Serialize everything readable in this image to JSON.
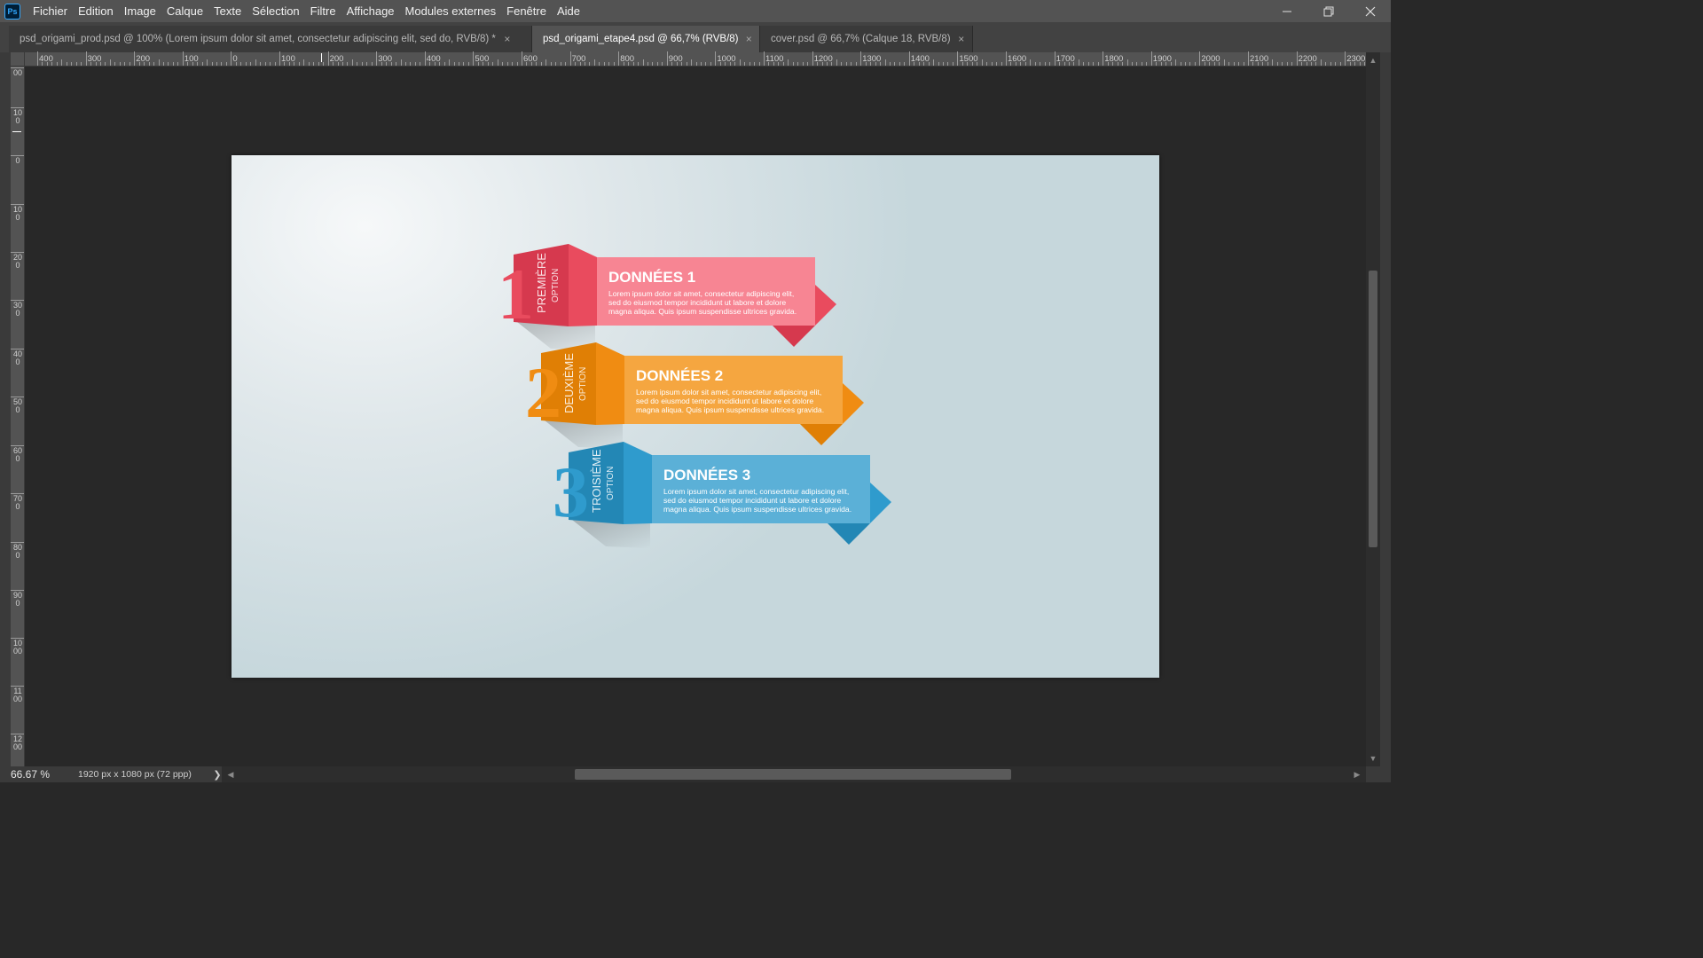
{
  "app": {
    "logo_text": "Ps",
    "menu": [
      "Fichier",
      "Edition",
      "Image",
      "Calque",
      "Texte",
      "Sélection",
      "Filtre",
      "Affichage",
      "Modules externes",
      "Fenêtre",
      "Aide"
    ]
  },
  "tabs": [
    {
      "label": "psd_origami_prod.psd @ 100% (Lorem ipsum dolor sit amet, consectetur adipiscing elit, sed do, RVB/8) *",
      "active": false
    },
    {
      "label": "psd_origami_etape4.psd @ 66,7% (RVB/8)",
      "active": true
    },
    {
      "label": "cover.psd @ 66,7% (Calque 18, RVB/8)",
      "active": false
    }
  ],
  "ruler_top_labels": [
    "400",
    "300",
    "200",
    "100",
    "0",
    "100",
    "200",
    "300",
    "400",
    "500",
    "600",
    "700",
    "800",
    "900",
    "1000",
    "1100",
    "1200",
    "1300",
    "1400",
    "1500",
    "1600",
    "1700",
    "1800",
    "1900",
    "2000",
    "2100",
    "2200",
    "2300"
  ],
  "ruler_left_labels": [
    "00",
    "100",
    "0",
    "100",
    "200",
    "300",
    "400",
    "500",
    "600",
    "700",
    "800",
    "900",
    "1000",
    "1100",
    "1200"
  ],
  "infographic": {
    "items": [
      {
        "number": "1",
        "vertical_main": "PREMIÈRE",
        "vertical_sub": "OPTION",
        "title": "DONNÉES 1",
        "body_lines": [
          "Lorem ipsum dolor sit amet, consectetur adipiscing elit,",
          "sed do eiusmod tempor incididunt ut labore et dolore",
          "magna aliqua. Quis ipsum suspendisse ultrices gravida."
        ],
        "color_dark": "#d6394e",
        "color_main": "#e94b5e",
        "color_light": "#f78593"
      },
      {
        "number": "2",
        "vertical_main": "DEUXIÈME",
        "vertical_sub": "OPTION",
        "title": "DONNÉES 2",
        "body_lines": [
          "Lorem ipsum dolor sit amet, consectetur adipiscing elit,",
          "sed do eiusmod tempor incididunt ut labore et dolore",
          "magna aliqua. Quis ipsum suspendisse ultrices gravida."
        ],
        "color_dark": "#e07f05",
        "color_main": "#f08c12",
        "color_light": "#f5a640"
      },
      {
        "number": "3",
        "vertical_main": "TROISIÈME",
        "vertical_sub": "OPTION",
        "title": "DONNÉES 3",
        "body_lines": [
          "Lorem ipsum dolor sit amet, consectetur adipiscing elit,",
          "sed do eiusmod tempor incididunt ut labore et dolore",
          "magna aliqua. Quis ipsum suspendisse ultrices gravida."
        ],
        "color_dark": "#2387b5",
        "color_main": "#2f9bcd",
        "color_light": "#5bb0d7"
      }
    ]
  },
  "status": {
    "zoom": "66.67 %",
    "doc_size": "1920 px x 1080 px (72 ppp)",
    "arrow": "❯"
  },
  "icons": {
    "minimize": "minimize-icon",
    "restore": "restore-icon",
    "close": "close-icon"
  }
}
